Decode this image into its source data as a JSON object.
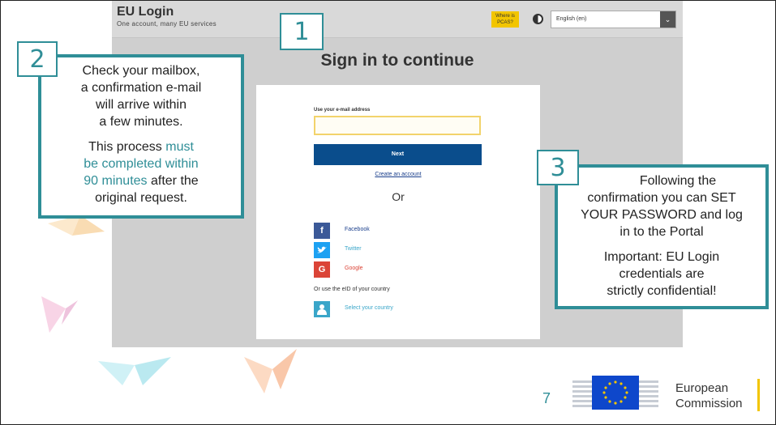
{
  "screenshot": {
    "brand_title": "EU Login",
    "brand_subtitle": "One account, many EU services",
    "help_badge": "Where is PCAS?",
    "language": "English (en)",
    "heading": "Sign in to continue",
    "email_label": "Use your e-mail address",
    "email_value": "",
    "next_button": "Next",
    "create_account_link": "Create an account",
    "or_text": "Or",
    "social": [
      {
        "label": "Facebook",
        "icon": "facebook-icon",
        "glyph": "f",
        "color": "#3b5998"
      },
      {
        "label": "Twitter",
        "icon": "twitter-icon",
        "glyph": "🐦",
        "color": "#1da1f2"
      },
      {
        "label": "Google",
        "icon": "google-icon",
        "glyph": "G",
        "color": "#db4437"
      }
    ],
    "eid_label": "Or use the eID of your country",
    "eid_link": "Select your country",
    "eid_icon": "person-icon",
    "eid_color": "#3aa6c9"
  },
  "callout1": {
    "number": "1"
  },
  "callout2": {
    "number": "2",
    "line1": "Check your mailbox,",
    "line2": "a confirmation e-mail",
    "line3": "will arrive within",
    "line4": "a few minutes.",
    "p2_pre": "This process ",
    "p2_hl1": "must",
    "p2_hl2": "be completed within",
    "p2_hl3": "90 minutes",
    "p2_post1": " after the",
    "p2_post2": "original request."
  },
  "callout3": {
    "number": "3",
    "line1": "Following the",
    "line2": "confirmation you can SET",
    "line3": "YOUR PASSWORD and log",
    "line4": "in to the Portal",
    "line5": "Important: EU Login",
    "line6": "credentials are",
    "line7": "strictly confidential!"
  },
  "footer": {
    "page_number": "7",
    "logo_line1": "European",
    "logo_line2": "Commission"
  },
  "colors": {
    "accent": "#2f8e97",
    "next_button": "#0a4d8c",
    "ec_blue": "#0e47cb",
    "ec_yellow": "#f2c500"
  }
}
